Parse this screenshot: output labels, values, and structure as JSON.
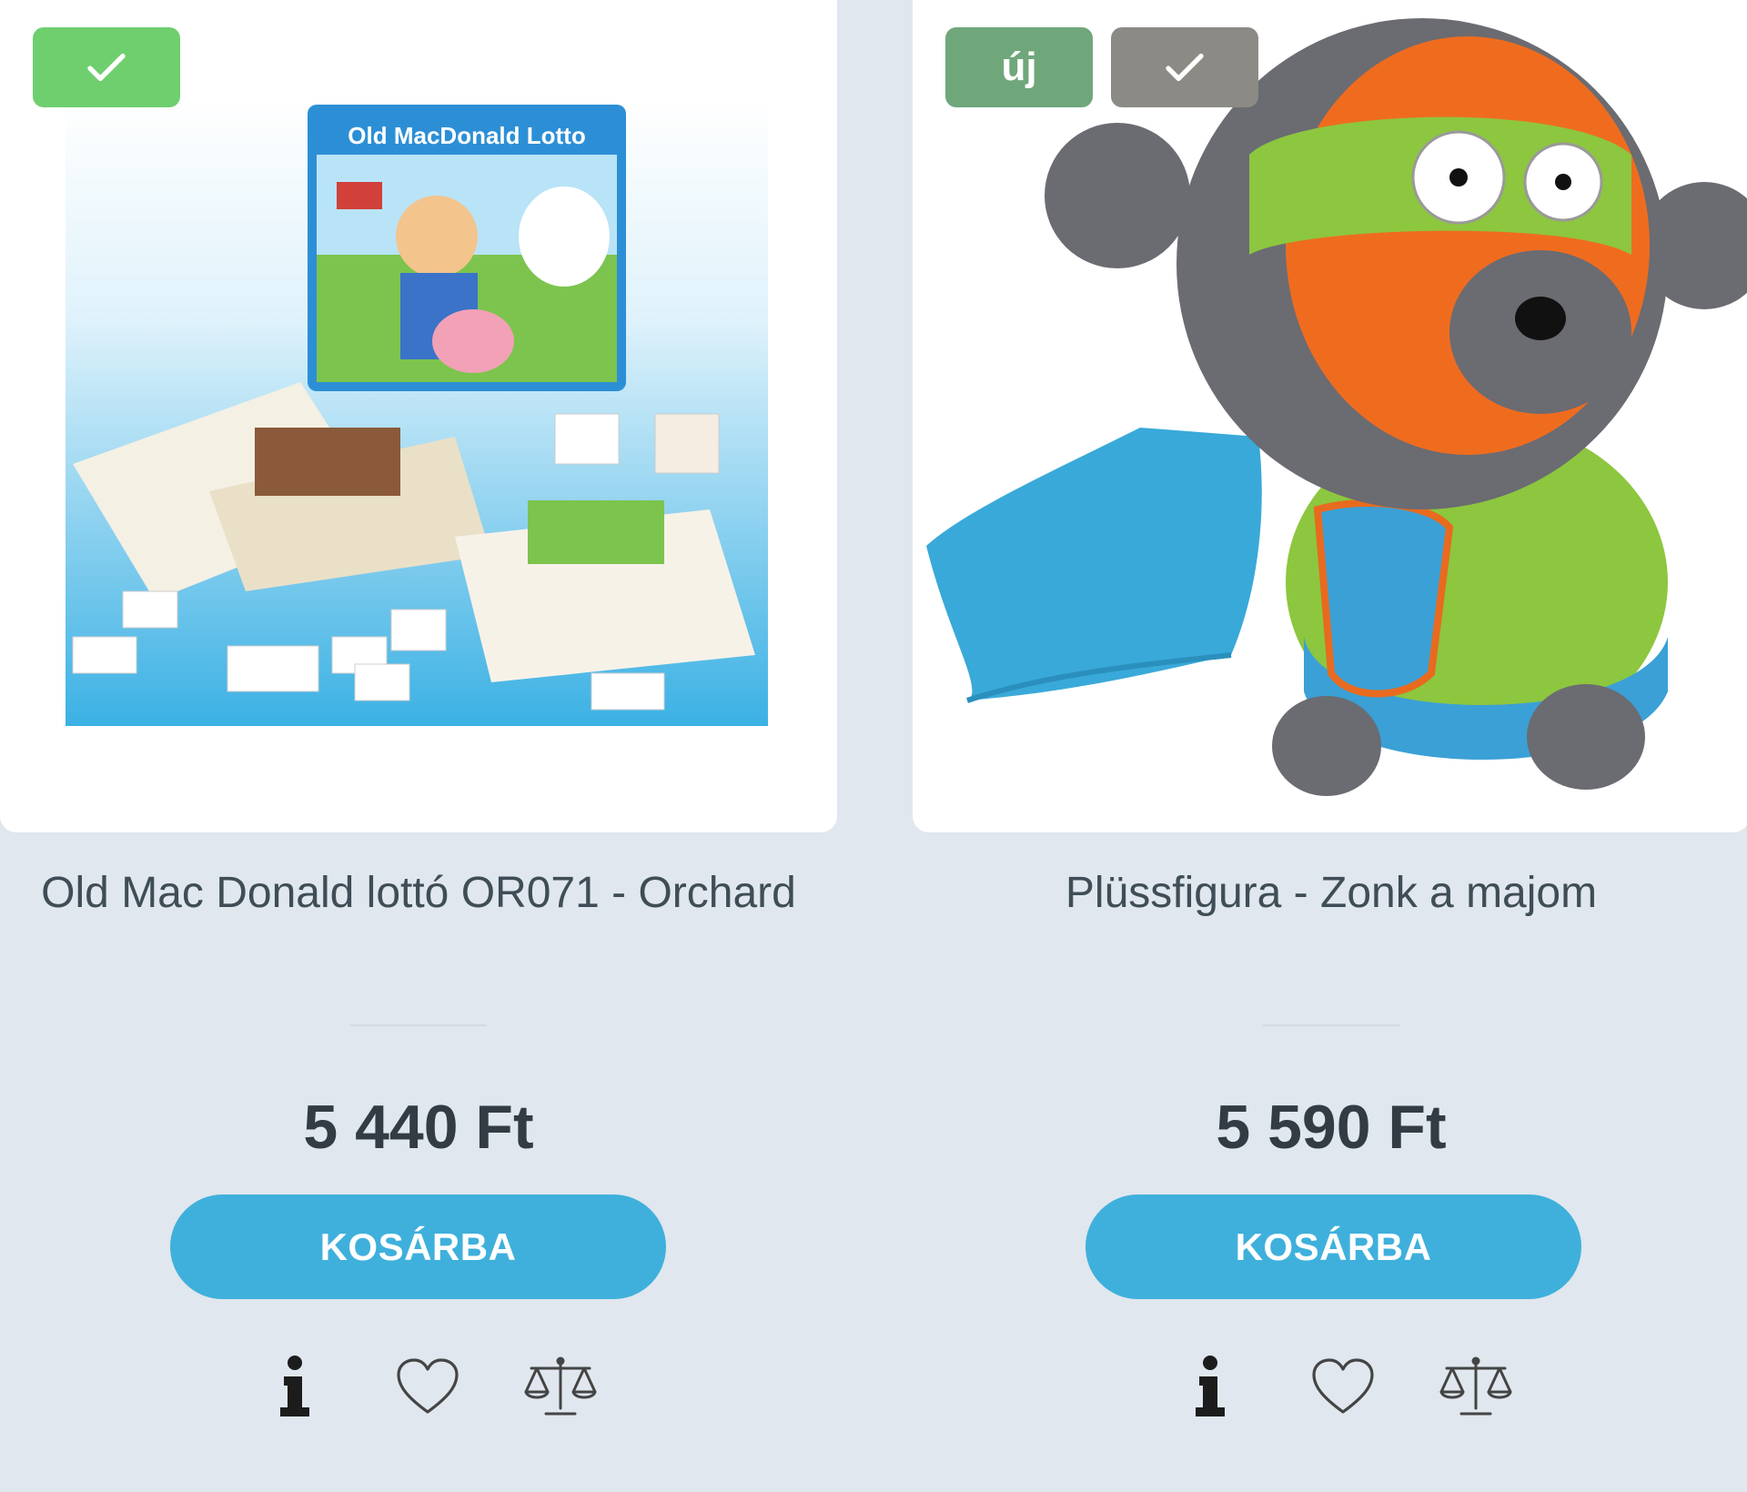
{
  "colors": {
    "page_bg": "#e0e7ee",
    "badge_check": "#6fcf6f",
    "badge_new": "#6fa77b",
    "badge_check_gray": "#8c8a84",
    "cart_button": "#3fb0dc"
  },
  "products": [
    {
      "badges": [
        {
          "type": "check-icon",
          "label": ""
        }
      ],
      "art_title": "Old MacDonald Lotto",
      "title": "Old Mac Donald lottó OR071 - Orchard",
      "price": "5 440 Ft",
      "cart_label": "KOSÁRBA",
      "actions": [
        "info-icon",
        "heart-icon",
        "compare-scale-icon"
      ]
    },
    {
      "badges": [
        {
          "type": "text",
          "label": "új"
        },
        {
          "type": "check-icon",
          "label": ""
        }
      ],
      "title": "Plüssfigura - Zonk a majom",
      "price": "5 590 Ft",
      "cart_label": "KOSÁRBA",
      "actions": [
        "info-icon",
        "heart-icon",
        "compare-scale-icon"
      ]
    }
  ]
}
